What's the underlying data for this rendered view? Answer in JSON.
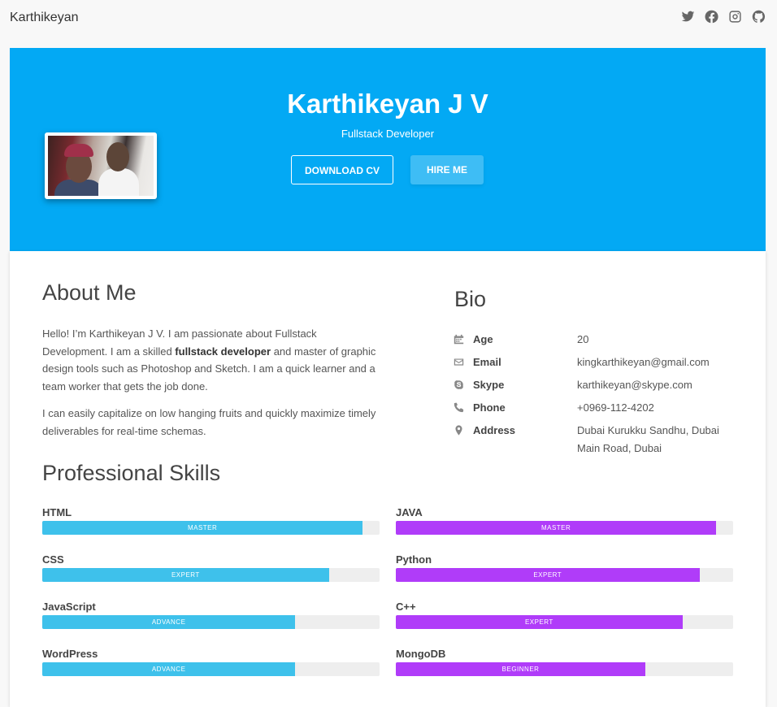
{
  "header": {
    "brand": "Karthikeyan",
    "social": [
      "twitter-icon",
      "facebook-icon",
      "instagram-icon",
      "github-icon"
    ]
  },
  "hero": {
    "name": "Karthikeyan J V",
    "title": "Fullstack Developer",
    "download_label": "DOWNLOAD CV",
    "hire_label": "HIRE ME",
    "background_color": "#03a9f4"
  },
  "about": {
    "heading": "About Me",
    "p1_pre": "Hello! I’m Karthikeyan J V. I am passionate about Fullstack Development. I am a skilled ",
    "p1_bold": "fullstack developer",
    "p1_post": " and master of graphic design tools such as Photoshop and Sketch. I am a quick learner and a team worker that gets the job done.",
    "p2": "I can easily capitalize on low hanging fruits and quickly maximize timely deliverables for real-time schemas."
  },
  "bio": {
    "heading": "Bio",
    "rows": [
      {
        "icon": "calendar-icon",
        "label": "Age",
        "value": "20"
      },
      {
        "icon": "envelope-icon",
        "label": "Email",
        "value": "kingkarthikeyan@gmail.com"
      },
      {
        "icon": "skype-icon",
        "label": "Skype",
        "value": "karthikeyan@skype.com"
      },
      {
        "icon": "phone-icon",
        "label": "Phone",
        "value": "+0969-112-4202"
      },
      {
        "icon": "map-marker-icon",
        "label": "Address",
        "value": "Dubai Kurukku Sandhu, Dubai Main Road, Dubai"
      }
    ]
  },
  "skills": {
    "heading": "Professional Skills",
    "colors": {
      "blue": "#3ec1eb",
      "purple": "#b03cf9"
    },
    "left": [
      {
        "name": "HTML",
        "level": "MASTER",
        "percent": 95
      },
      {
        "name": "CSS",
        "level": "EXPERT",
        "percent": 85
      },
      {
        "name": "JavaScript",
        "level": "ADVANCE",
        "percent": 75
      },
      {
        "name": "WordPress",
        "level": "ADVANCE",
        "percent": 75
      }
    ],
    "right": [
      {
        "name": "JAVA",
        "level": "MASTER",
        "percent": 95
      },
      {
        "name": "Python",
        "level": "EXPERT",
        "percent": 90
      },
      {
        "name": "C++",
        "level": "EXPERT",
        "percent": 85
      },
      {
        "name": "MongoDB",
        "level": "BEGINNER",
        "percent": 74
      }
    ]
  }
}
